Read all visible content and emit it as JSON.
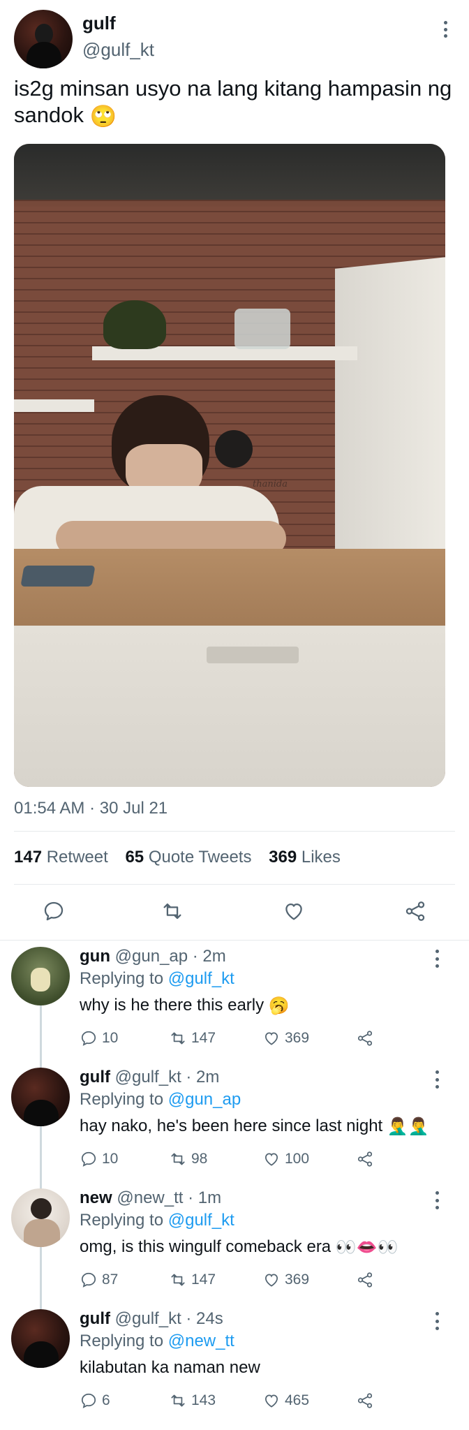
{
  "tweet": {
    "author_name": "gulf",
    "author_handle": "@gulf_kt",
    "text": "is2g minsan usyo na lang kitang hampasin ng sandok",
    "text_emoji": "🙄",
    "timestamp": "01:54 AM · 30 Jul 21",
    "stats": {
      "retweets_count": "147",
      "retweets_label": "Retweet",
      "quotes_count": "65",
      "quotes_label": "Quote Tweets",
      "likes_count": "369",
      "likes_label": "Likes"
    },
    "photo_watermark": "thanida"
  },
  "icons": {
    "reply": "reply-icon",
    "retweet": "retweet-icon",
    "like": "heart-icon",
    "share": "share-icon",
    "more": "more-dots-icon"
  },
  "colors": {
    "mention": "#1d9bf0",
    "secondary_text": "#536471",
    "divider": "#e6e9ec",
    "thread_line": "#cfd9de"
  },
  "replies": [
    {
      "name": "gun",
      "meta": "@gun_ap · 2m",
      "replying_label": "Replying to",
      "replying_to": "@gulf_kt",
      "text": "why is he there this early",
      "emoji": "🥱",
      "replies": "10",
      "retweets": "147",
      "likes": "369"
    },
    {
      "name": "gulf",
      "meta": "@gulf_kt · 2m",
      "replying_label": "Replying to",
      "replying_to": "@gun_ap",
      "text": "hay nako, he's been here since last night",
      "emoji": "🤦‍♂️🤦‍♂️",
      "replies": "10",
      "retweets": "98",
      "likes": "100"
    },
    {
      "name": "new",
      "meta": "@new_tt · 1m",
      "replying_label": "Replying to",
      "replying_to": "@gulf_kt",
      "text": "omg, is this wingulf comeback era",
      "emoji": "👀👄👀",
      "replies": "87",
      "retweets": "147",
      "likes": "369"
    },
    {
      "name": "gulf",
      "meta": "@gulf_kt · 24s",
      "replying_label": "Replying to",
      "replying_to": "@new_tt",
      "text": "kilabutan ka naman new",
      "emoji": "",
      "replies": "6",
      "retweets": "143",
      "likes": "465"
    }
  ]
}
